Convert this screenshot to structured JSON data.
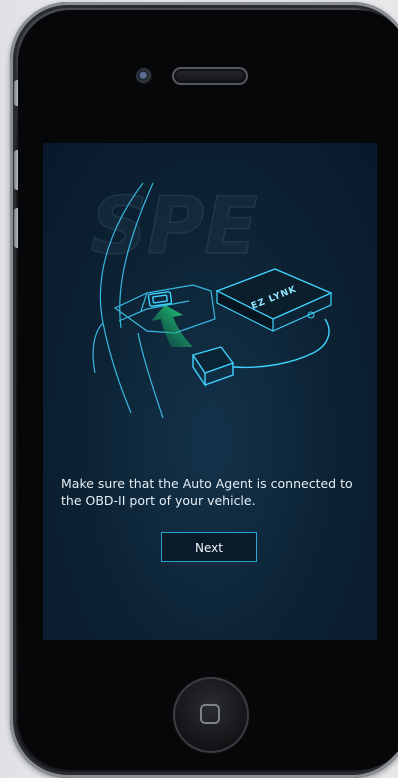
{
  "screen": {
    "instruction": "Make sure that the Auto Agent is connected to the OBD-II port of your vehicle.",
    "next_label": "Next",
    "device_label": "EZ LYNK",
    "watermark": "SPE"
  },
  "colors": {
    "screen_bg": "#0c2233",
    "line_art": "#3fd2ff",
    "arrow": "#29e07a",
    "button_border": "#2aa6d6"
  },
  "icons": {
    "camera": "front-camera-icon",
    "speaker": "earpiece-icon",
    "home": "home-button-icon",
    "arrow": "arrow-up-icon"
  }
}
